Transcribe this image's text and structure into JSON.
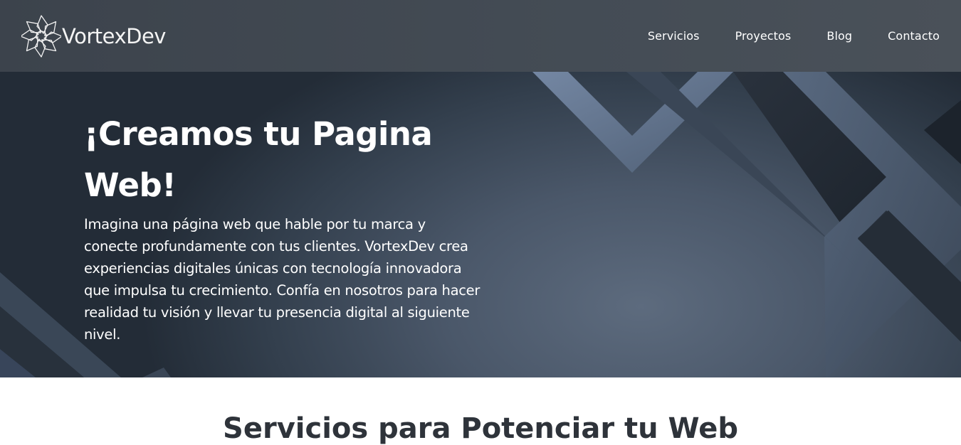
{
  "header": {
    "logo": {
      "text": "VortexDev",
      "icon": "vortex-spiral-logo"
    },
    "nav": [
      {
        "label": "Servicios"
      },
      {
        "label": "Proyectos"
      },
      {
        "label": "Blog"
      },
      {
        "label": "Contacto"
      }
    ]
  },
  "hero": {
    "title": "¡Creamos tu Pagina Web!",
    "description": "Imagina una página web que hable por tu marca y conecte profundamente con tus clientes. VortexDev crea experiencias digitales únicas con tecnología innovadora que impulsa tu crecimiento. Confía en nosotros para hacer realidad tu visión y llevar tu presencia digital al siguiente nivel."
  },
  "section": {
    "heading": "Servicios para Potenciar tu Web"
  },
  "colors": {
    "header_bg": "#444c55",
    "hero_dark": "#232c37",
    "hero_light": "#5d6b7e",
    "stripe_accent": "#6d7e99",
    "text_white": "#ffffff",
    "heading_dark": "#2e333a"
  }
}
